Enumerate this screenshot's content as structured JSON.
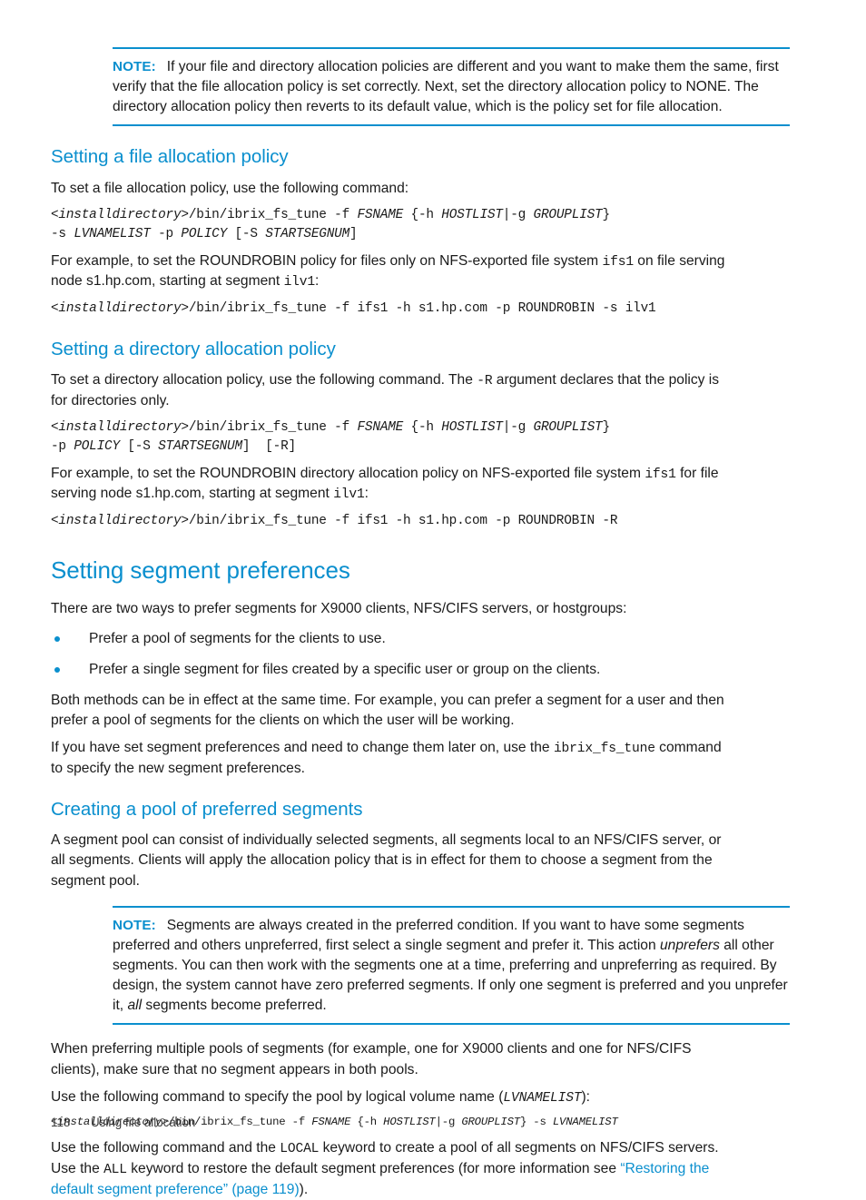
{
  "colors": {
    "accent": "#0a8fce",
    "text": "#1a1a1a",
    "background": "#ffffff"
  },
  "notes": {
    "note1": {
      "label": "NOTE:",
      "text": "If your file and directory allocation policies are different and you want to make them the same, first verify that the file allocation policy is set correctly. Next, set the directory allocation policy to NONE. The directory allocation policy then reverts to its default value, which is the policy set for file allocation."
    },
    "note2": {
      "label": "NOTE:",
      "text_part1": "Segments are always created in the preferred condition. If you want to have some segments preferred and others unpreferred, first select a single segment and prefer it. This action ",
      "emphasis1": "unprefers",
      "text_part2": " all other segments. You can then work with the segments one at a time, preferring and unpreferring as required. By design, the system cannot have zero preferred segments. If only one segment is preferred and you unprefer it, ",
      "emphasis2": "all",
      "text_part3": " segments become preferred."
    }
  },
  "sections": {
    "file_allocation": {
      "heading": "Setting a file allocation policy",
      "intro": "To set a file allocation policy, use the following command:",
      "syntax_line1_a": "<installdirectory>",
      "syntax_line1_b": "/bin/ibrix_fs_tune -f ",
      "syntax_line1_c": "FSNAME",
      "syntax_line1_d": " {-h ",
      "syntax_line1_e": "HOSTLIST",
      "syntax_line1_f": "|-g ",
      "syntax_line1_g": "GROUPLIST",
      "syntax_line1_h": "}",
      "syntax_line2_a": "-s ",
      "syntax_line2_b": "LVNAMELIST",
      "syntax_line2_c": " -p ",
      "syntax_line2_d": "POLICY",
      "syntax_line2_e": " [-S ",
      "syntax_line2_f": "STARTSEGNUM",
      "syntax_line2_g": "]",
      "example_intro_1": "For example, to set the ROUNDROBIN policy for files only on NFS-exported file system ",
      "example_code_1": "ifs1",
      "example_intro_2": " on file serving node s1.hp.com, starting at segment ",
      "example_code_2": "ilv1",
      "example_intro_3": ":",
      "example_cmd_italic": "<installdirectory>",
      "example_cmd_rest": "/bin/ibrix_fs_tune -f ifs1 -h s1.hp.com -p ROUNDROBIN -s ilv1"
    },
    "directory_allocation": {
      "heading": "Setting a directory allocation policy",
      "intro_1": "To set a directory allocation policy, use the following command. The ",
      "intro_code": "-R",
      "intro_2": " argument declares that the policy is for directories only.",
      "syntax_line1_a": "<installdirectory>",
      "syntax_line1_b": "/bin/ibrix_fs_tune -f ",
      "syntax_line1_c": "FSNAME",
      "syntax_line1_d": " {-h ",
      "syntax_line1_e": "HOSTLIST",
      "syntax_line1_f": "|-g ",
      "syntax_line1_g": "GROUPLIST",
      "syntax_line1_h": "}",
      "syntax_line2_a": "-p ",
      "syntax_line2_b": "POLICY",
      "syntax_line2_c": " [-S ",
      "syntax_line2_d": "STARTSEGNUM",
      "syntax_line2_e": "]  [-R]",
      "example_intro_1": "For example, to set the ROUNDROBIN directory allocation policy on NFS-exported file system ",
      "example_code_1": "ifs1",
      "example_intro_2": " for file serving node s1.hp.com, starting at segment ",
      "example_code_2": "ilv1",
      "example_intro_3": ":",
      "example_cmd_italic": "<installdirectory>",
      "example_cmd_rest": "/bin/ibrix_fs_tune -f ifs1 -h s1.hp.com -p ROUNDROBIN -R"
    },
    "segment_preferences": {
      "heading": "Setting segment preferences",
      "intro": "There are two ways to prefer segments for X9000 clients, NFS/CIFS servers, or hostgroups:",
      "bullets": [
        "Prefer a pool of segments for the clients to use.",
        "Prefer a single segment for files created by a specific user or group on the clients."
      ],
      "para1": "Both methods can be in effect at the same time. For example, you can prefer a segment for a user and then prefer a pool of segments for the clients on which the user will be working.",
      "para2_a": "If you have set segment preferences and need to change them later on, use the ",
      "para2_code": "ibrix_fs_tune",
      "para2_b": " command to specify the new segment preferences."
    },
    "pool_preferred": {
      "heading": "Creating a pool of preferred segments",
      "para1": "A segment pool can consist of individually selected segments, all segments local to an NFS/CIFS server, or all segments. Clients will apply the allocation policy that is in effect for them to choose a segment from the segment pool.",
      "para2": "When preferring multiple pools of segments (for example, one for X9000 clients and one for NFS/CIFS clients), make sure that no segment appears in both pools.",
      "para3_a": "Use the following command to specify the pool by logical volume name (",
      "para3_italic": "LVNAMELIST",
      "para3_b": "):",
      "syntax_a": "<installdirectory>",
      "syntax_b": "/bin/ibrix_fs_tune -f ",
      "syntax_c": "FSNAME",
      "syntax_d": " {-h ",
      "syntax_e": "HOSTLIST",
      "syntax_f": "|-g ",
      "syntax_g": "GROUPLIST",
      "syntax_h": "} -s ",
      "syntax_i": "LVNAMELIST",
      "para4_a": "Use the following command and the ",
      "para4_code1": "LOCAL",
      "para4_b": " keyword to create a pool of all segments on NFS/CIFS servers. Use the ",
      "para4_code2": "ALL",
      "para4_c": " keyword to restore the default segment preferences (for more information see ",
      "para4_link": "“Restoring the default segment preference” (page 119)",
      "para4_d": ")."
    }
  },
  "footer": {
    "page_number": "118",
    "chapter_title": "Using file allocation"
  }
}
